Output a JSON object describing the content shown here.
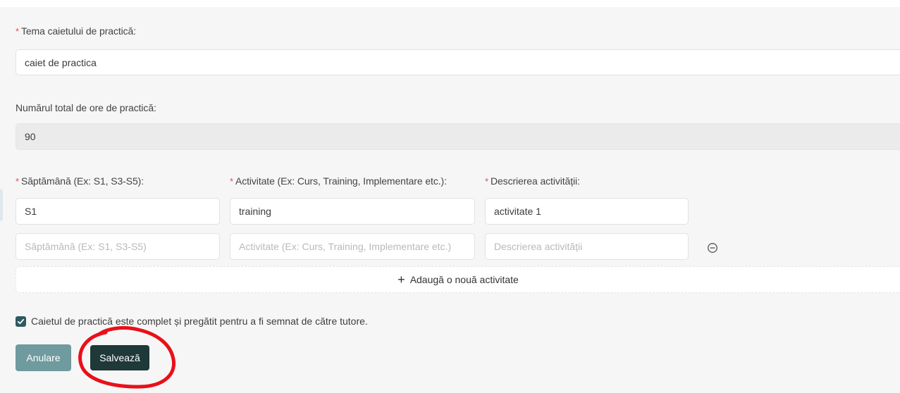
{
  "form": {
    "theme": {
      "required_mark": "*",
      "label": "Tema caietului de practică:",
      "value": "caiet de practica"
    },
    "hours": {
      "label": "Numărul total de ore de practică:",
      "value": "90"
    },
    "activities": {
      "columns": [
        {
          "required_mark": "*",
          "label": "Săptămână (Ex: S1, S3-S5):"
        },
        {
          "required_mark": "*",
          "label": "Activitate (Ex: Curs, Training, Implementare etc.):"
        },
        {
          "required_mark": "*",
          "label": "Descrierea activității:"
        }
      ],
      "rows": [
        {
          "week": "S1",
          "activity": "training",
          "description": "activitate 1"
        },
        {
          "week": "",
          "activity": "",
          "description": ""
        }
      ],
      "placeholders": {
        "week": "Săptămână (Ex: S1, S3-S5)",
        "activity": "Activitate (Ex: Curs, Training, Implementare etc.)",
        "description": "Descrierea activității"
      },
      "remove_icon": "minus-circle-icon",
      "add_icon": "plus-icon",
      "add_label": "Adaugă o nouă activitate"
    },
    "complete_checkbox": {
      "checked": true,
      "label": "Caietul de practică este complet și pregătit pentru a fi semnat de către tutore."
    },
    "buttons": {
      "cancel": "Anulare",
      "save": "Salvează"
    }
  },
  "colors": {
    "required": "#e74c4c",
    "cancel_bg": "#6f9a9e",
    "save_bg": "#1f3838",
    "checkbox": "#2e5a63",
    "annotation": "#e8101a"
  }
}
